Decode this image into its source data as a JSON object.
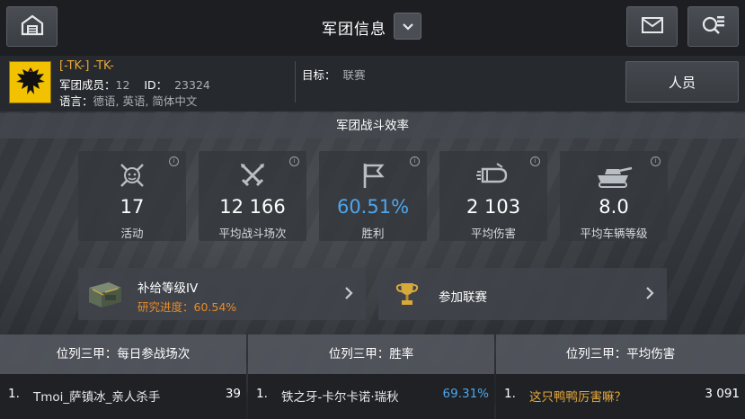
{
  "header": {
    "title": "军团信息"
  },
  "clan": {
    "name": "[-TK-] -TK-",
    "members_label": "军团成员：",
    "members_count": "12",
    "id_label": "ID：",
    "id_value": "23324",
    "language_label": "语言：",
    "languages": "德语, 英语, 简体中文",
    "target_label": "目标：",
    "target_value": "联赛"
  },
  "members_button": "人员",
  "section_title": "军团战斗效率",
  "stats": [
    {
      "icon": "activity-icon",
      "value": "17",
      "label": "活动"
    },
    {
      "icon": "crossed-swords-icon",
      "value": "12 166",
      "label": "平均战斗场次"
    },
    {
      "icon": "flag-icon",
      "value": "60.51%",
      "label": "胜利",
      "color": "#4ea6ec"
    },
    {
      "icon": "shell-damage-icon",
      "value": "2 103",
      "label": "平均伤害"
    },
    {
      "icon": "tank-icon",
      "value": "8.0",
      "label": "平均车辆等级"
    }
  ],
  "supply": {
    "title": "补给等级IV",
    "progress": "研究进度：60.54%"
  },
  "league": {
    "title": "参加联赛"
  },
  "leaderboards": [
    {
      "title": "位列三甲：每日参战场次",
      "rank": "1.",
      "player": "Tmoi_萨镇冰_亲人杀手",
      "value": "39"
    },
    {
      "title": "位列三甲：胜率",
      "rank": "1.",
      "player": "铁之牙-卡尔卡诺·瑞秋",
      "value": "69.31%"
    },
    {
      "title": "位列三甲：平均伤害",
      "rank": "1.",
      "player": "这只鸭鸭厉害嘛？",
      "value": "3 091"
    }
  ],
  "colors": {
    "accent_blue": "#4ea6ec",
    "accent_orange": "#e8a93a",
    "progress_orange": "#e98a26"
  }
}
